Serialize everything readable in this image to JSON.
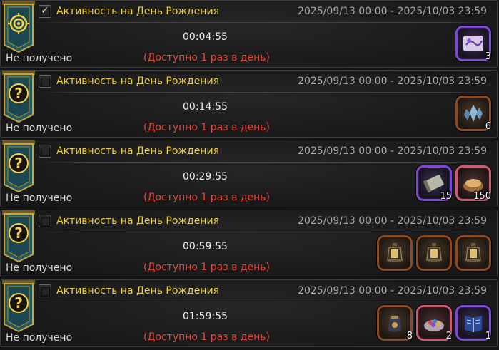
{
  "colors": {
    "title": "#f1cf37",
    "note": "#e2483a",
    "timer": "#f0f0f0",
    "period": "#a8a8a8",
    "status": "#d8d8d8",
    "slot_orange": "#8a4a22",
    "slot_purple": "#7b4ad2",
    "slot_pink": "#c95a72"
  },
  "rows": [
    {
      "icon": "target-emblem-icon",
      "checked": true,
      "title": "Активность на День Рождения",
      "period": "2025/09/13 00:00 - 2025/10/03 23:59",
      "timer": "00:04:55",
      "note": "(Доступно 1 раз в день)",
      "status": "Не получено",
      "rewards": [
        {
          "icon": "scroll-map-icon",
          "rarity": "epic",
          "qty": "3"
        }
      ]
    },
    {
      "icon": "question-emblem-icon",
      "checked": false,
      "title": "Активность на День Рождения",
      "period": "2025/09/13 00:00 - 2025/10/03 23:59",
      "timer": "00:14:55",
      "note": "(Доступно 1 раз в день)",
      "status": "Не получено",
      "rewards": [
        {
          "icon": "crystal-shards-icon",
          "rarity": "orange",
          "qty": "6"
        }
      ]
    },
    {
      "icon": "question-emblem-icon",
      "checked": false,
      "title": "Активность на День Рождения",
      "period": "2025/09/13 00:00 - 2025/10/03 23:59",
      "timer": "00:29:55",
      "note": "(Доступно 1 раз в день)",
      "status": "Не получено",
      "rewards": [
        {
          "icon": "rolled-scroll-icon",
          "rarity": "epic",
          "qty": "15"
        },
        {
          "icon": "gold-ingot-icon",
          "rarity": "pink",
          "qty": "150"
        }
      ]
    },
    {
      "icon": "question-emblem-icon",
      "checked": false,
      "title": "Активность на День Рождения",
      "period": "2025/09/13 00:00 - 2025/10/03 23:59",
      "timer": "00:59:55",
      "note": "(Доступно 1 раз в день)",
      "status": "Не получено",
      "rewards": [
        {
          "icon": "lantern-icon",
          "rarity": "orange",
          "qty": ""
        },
        {
          "icon": "lantern-icon",
          "rarity": "orange",
          "qty": ""
        },
        {
          "icon": "lantern-icon",
          "rarity": "orange",
          "qty": ""
        }
      ]
    },
    {
      "icon": "question-emblem-icon",
      "checked": false,
      "title": "Активность на День Рождения",
      "period": "2025/09/13 00:00 - 2025/10/03 23:59",
      "timer": "01:59:55",
      "note": "(Доступно 1 раз в день)",
      "status": "Не получено",
      "rewards": [
        {
          "icon": "pouch-icon",
          "rarity": "orange",
          "qty": "8"
        },
        {
          "icon": "gem-bowl-icon",
          "rarity": "pink",
          "qty": "2"
        },
        {
          "icon": "blue-book-icon",
          "rarity": "epic",
          "qty": "1"
        }
      ]
    }
  ]
}
